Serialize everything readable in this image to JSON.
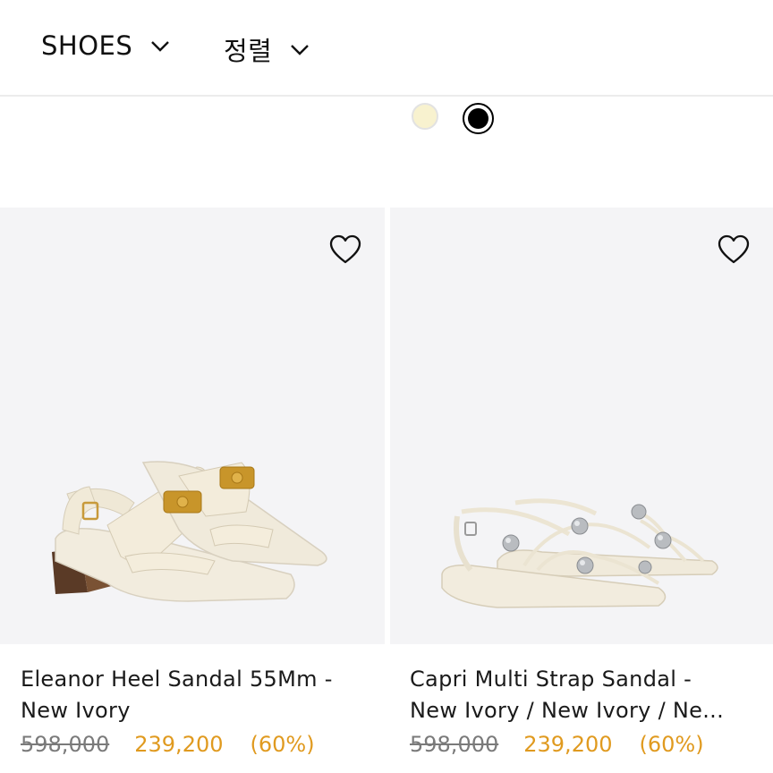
{
  "filters": {
    "category_label": "SHOES",
    "sort_label": "정렬"
  },
  "swatches": [
    {
      "name": "ivory",
      "color": "#f8f2cf"
    },
    {
      "name": "black",
      "color": "#000000"
    }
  ],
  "products": [
    {
      "name_line1": "Eleanor Heel Sandal 55Mm -",
      "name_line2": "New Ivory",
      "original_price": "598,000",
      "sale_price": "239,200",
      "discount": "(60%)"
    },
    {
      "name_line1": "Capri Multi Strap Sandal -",
      "name_line2": "New Ivory / New Ivory / Ne...",
      "original_price": "598,000",
      "sale_price": "239,200",
      "discount": "(60%)"
    }
  ],
  "colors": {
    "sale": "#e09a1f",
    "original": "#7a7a7a",
    "image_bg": "#f4f4f6"
  }
}
